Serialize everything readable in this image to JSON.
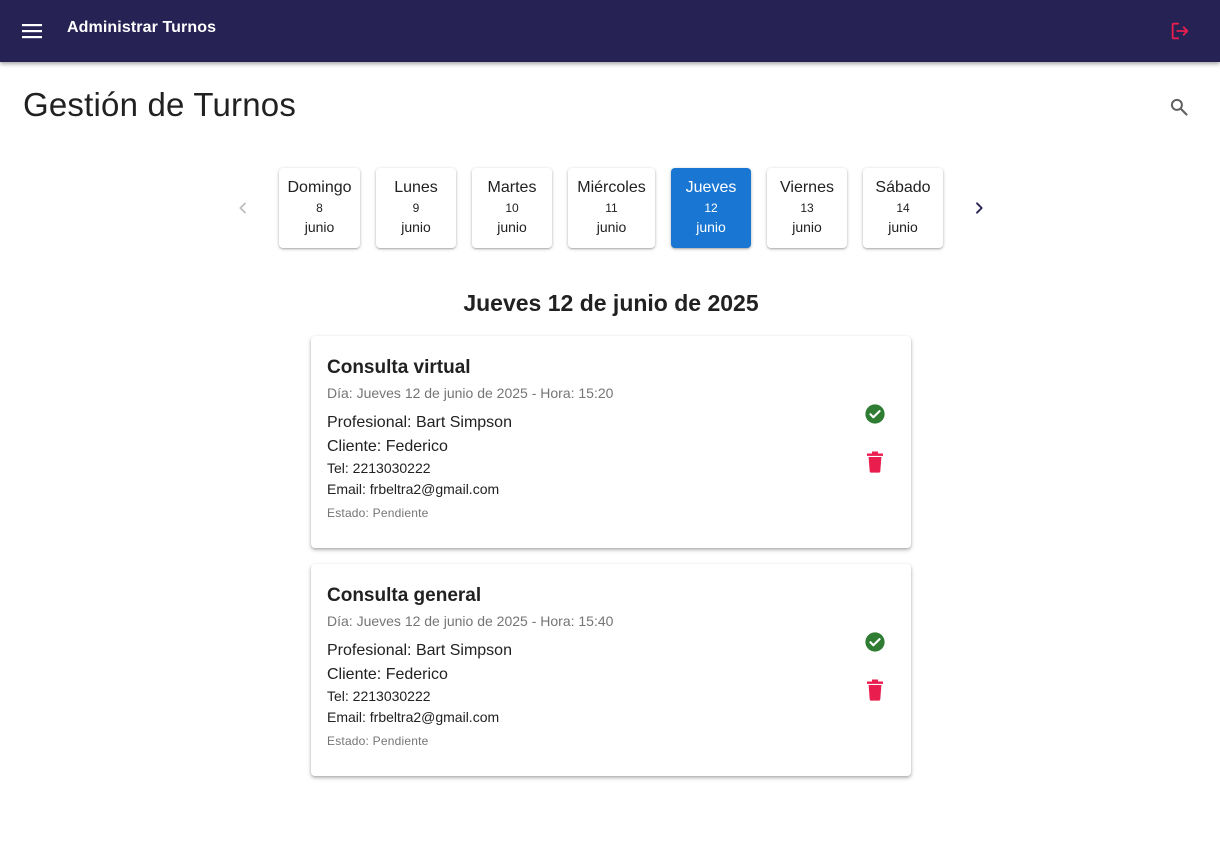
{
  "appbar": {
    "title": "Administrar Turnos",
    "menu_icon": "menu-icon",
    "logout_icon": "logout-icon"
  },
  "page": {
    "title": "Gestión de Turnos",
    "search_icon": "search-icon"
  },
  "day_selector": {
    "prev_icon": "chevron-left-icon",
    "next_icon": "chevron-right-icon",
    "days": [
      {
        "name": "Domingo",
        "num": "8",
        "month": "junio"
      },
      {
        "name": "Lunes",
        "num": "9",
        "month": "junio"
      },
      {
        "name": "Martes",
        "num": "10",
        "month": "junio"
      },
      {
        "name": "Miércoles",
        "num": "11",
        "month": "junio"
      },
      {
        "name": "Jueves",
        "num": "12",
        "month": "junio",
        "selected": true
      },
      {
        "name": "Viernes",
        "num": "13",
        "month": "junio"
      },
      {
        "name": "Sábado",
        "num": "14",
        "month": "junio"
      }
    ]
  },
  "date_heading": "Jueves 12 de junio de 2025",
  "appointments": [
    {
      "title": "Consulta virtual",
      "when": "Día: Jueves 12 de junio de 2025 - Hora: 15:20",
      "profesional": "Profesional: Bart Simpson",
      "cliente": "Cliente: Federico",
      "tel": "Tel: 2213030222",
      "email": "Email: frbeltra2@gmail.com",
      "estado": "Estado: Pendiente"
    },
    {
      "title": "Consulta general",
      "when": "Día: Jueves 12 de junio de 2025 - Hora: 15:40",
      "profesional": "Profesional: Bart Simpson",
      "cliente": "Cliente: Federico",
      "tel": "Tel: 2213030222",
      "email": "Email: frbeltra2@gmail.com",
      "estado": "Estado: Pendiente"
    }
  ],
  "colors": {
    "appbar": "#262254",
    "selected_day": "#1976d2",
    "confirm": "#2e7d32",
    "delete": "#e91e4f",
    "logout": "#e91e4f"
  }
}
